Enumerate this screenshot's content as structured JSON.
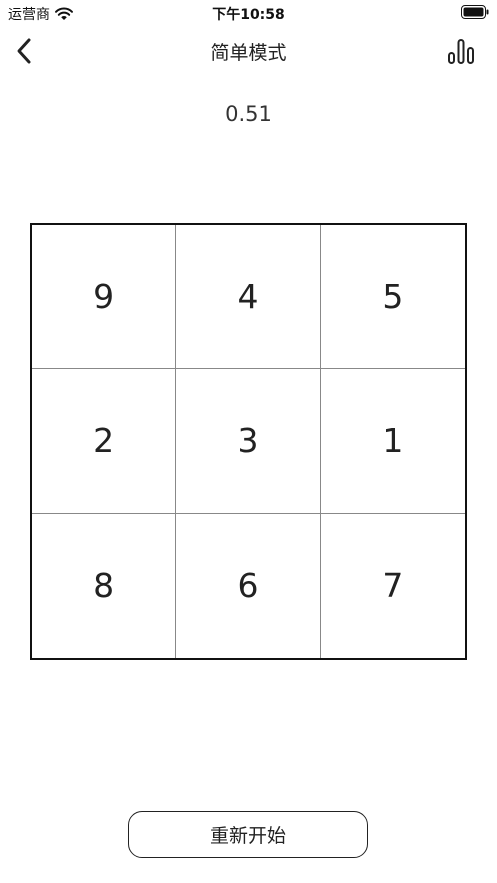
{
  "status_bar": {
    "carrier": "运营商",
    "time": "下午10:58",
    "icons": [
      "wifi-icon",
      "battery-icon"
    ]
  },
  "nav": {
    "title": "简单模式",
    "back_icon": "chevron-left-icon",
    "stats_icon": "bar-chart-icon"
  },
  "timer": {
    "value": "0.51"
  },
  "grid": {
    "rows": [
      [
        "9",
        "4",
        "5"
      ],
      [
        "2",
        "3",
        "1"
      ],
      [
        "8",
        "6",
        "7"
      ]
    ]
  },
  "actions": {
    "restart_label": "重新开始"
  },
  "colors": {
    "background": "#ffffff",
    "text": "#222222",
    "grid_border": "#111111",
    "cell_divider": "#888888"
  }
}
